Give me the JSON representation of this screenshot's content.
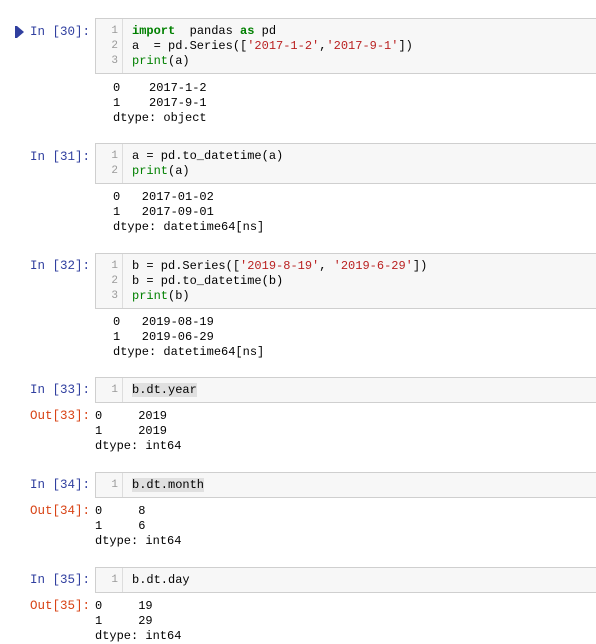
{
  "cells": [
    {
      "prompt": "In  [30]:",
      "code": [
        [
          [
            "kw",
            "import"
          ],
          [
            "",
            "  pandas "
          ],
          [
            "kw",
            "as"
          ],
          [
            "",
            " pd"
          ]
        ],
        [
          [
            "",
            "a  = pd.Series(["
          ],
          [
            "str",
            "'2017-1-2'"
          ],
          [
            "",
            ","
          ],
          [
            "str",
            "'2017-9-1'"
          ],
          [
            "",
            "])"
          ]
        ],
        [
          [
            "bi",
            "print"
          ],
          [
            "",
            "(a)"
          ]
        ]
      ],
      "output": [
        "0    2017-1-2",
        "1    2017-9-1",
        "dtype: object"
      ]
    },
    {
      "prompt": "In  [31]:",
      "code": [
        [
          [
            "",
            "a = pd.to_datetime(a)"
          ]
        ],
        [
          [
            "bi",
            "print"
          ],
          [
            "",
            "(a)"
          ]
        ]
      ],
      "output": [
        "0   2017-01-02",
        "1   2017-09-01",
        "dtype: datetime64[ns]"
      ]
    },
    {
      "prompt": "In  [32]:",
      "code": [
        [
          [
            "",
            "b = pd.Series(["
          ],
          [
            "str",
            "'2019-8-19'"
          ],
          [
            "",
            ", "
          ],
          [
            "str",
            "'2019-6-29'"
          ],
          [
            "",
            "])"
          ]
        ],
        [
          [
            "",
            "b = pd.to_datetime(b)"
          ]
        ],
        [
          [
            "bi",
            "print"
          ],
          [
            "",
            "(b)"
          ]
        ]
      ],
      "output": [
        "0   2019-08-19",
        "1   2019-06-29",
        "dtype: datetime64[ns]"
      ]
    },
    {
      "prompt": "In  [33]:",
      "out_prompt": "Out[33]:",
      "code": [
        [
          [
            "hl",
            "b.dt.year"
          ]
        ]
      ],
      "output": [
        "0     2019",
        "1     2019",
        "dtype: int64"
      ]
    },
    {
      "prompt": "In  [34]:",
      "out_prompt": "Out[34]:",
      "code": [
        [
          [
            "hl",
            "b.dt.month"
          ]
        ]
      ],
      "output": [
        "0     8",
        "1     6",
        "dtype: int64"
      ]
    },
    {
      "prompt": "In  [35]:",
      "out_prompt": "Out[35]:",
      "code": [
        [
          [
            "",
            "b.dt.day"
          ]
        ]
      ],
      "output": [
        "0     19",
        "1     29",
        "dtype: int64"
      ]
    }
  ]
}
